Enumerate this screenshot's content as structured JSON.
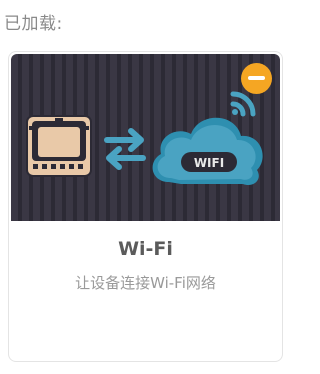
{
  "header": {
    "loaded_label": "已加载:"
  },
  "extension": {
    "title": "Wi-Fi",
    "description": "让设备连接Wi-Fi网络",
    "cloud_text": "WIFI",
    "icon": "wifi-cloud-illustration",
    "remove_icon": "minus-icon"
  },
  "colors": {
    "accent": "#f5a623",
    "cloud": "#4aa3c2",
    "board": "#e9c9a8",
    "banner_bg": "#35323e"
  }
}
